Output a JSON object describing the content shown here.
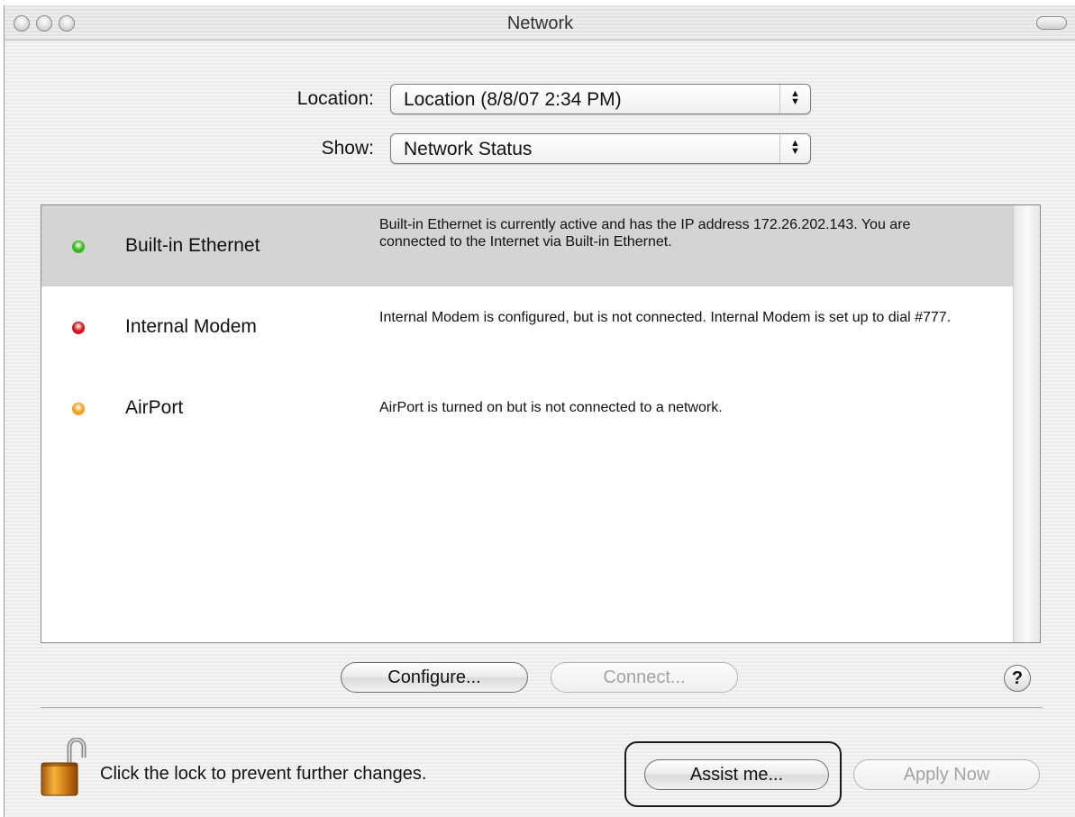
{
  "window": {
    "title": "Network"
  },
  "location": {
    "label": "Location:",
    "value": "Location (8/8/07 2:34 PM)"
  },
  "show": {
    "label": "Show:",
    "value": "Network Status"
  },
  "services": [
    {
      "name": "Built-in Ethernet",
      "status": "active",
      "status_color": "#37b81f",
      "description": "Built-in Ethernet is currently active and has the IP address 172.26.202.143. You are connected to the Internet via Built-in Ethernet.",
      "selected": true
    },
    {
      "name": "Internal Modem",
      "status": "not-connected",
      "status_color": "#d3141b",
      "description": "Internal Modem is configured, but is not connected. Internal Modem is set up to dial #777.",
      "selected": false
    },
    {
      "name": "AirPort",
      "status": "on-not-connected",
      "status_color": "#f2a21c",
      "description": "AirPort is turned on but is not connected to a network.",
      "selected": false
    }
  ],
  "buttons": {
    "configure": "Configure...",
    "connect": "Connect...",
    "help": "?",
    "assist": "Assist me...",
    "apply": "Apply Now"
  },
  "lock": {
    "text": "Click the lock to prevent further changes.",
    "icon": "unlocked-padlock-icon"
  }
}
